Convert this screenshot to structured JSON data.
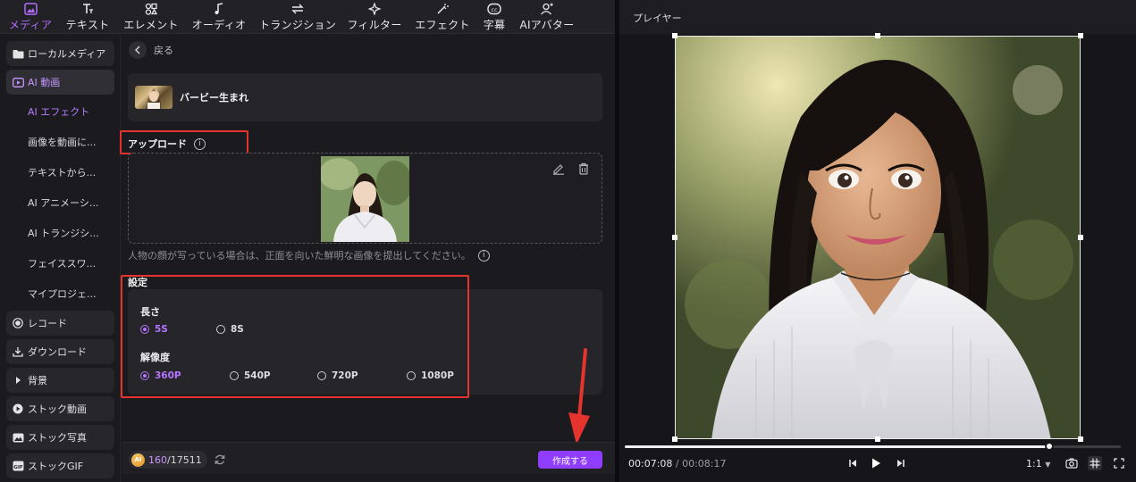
{
  "toolbar": {
    "items": [
      {
        "label": "メディア",
        "icon": "media-icon"
      },
      {
        "label": "テキスト",
        "icon": "text-icon"
      },
      {
        "label": "エレメント",
        "icon": "element-icon"
      },
      {
        "label": "オーディオ",
        "icon": "audio-icon"
      },
      {
        "label": "トランジション",
        "icon": "transition-icon"
      },
      {
        "label": "フィルター",
        "icon": "filter-icon"
      },
      {
        "label": "エフェクト",
        "icon": "effect-icon"
      },
      {
        "label": "字幕",
        "icon": "subtitle-icon"
      },
      {
        "label": "AIアバター",
        "icon": "ai-avatar-icon"
      }
    ],
    "active": "メディア"
  },
  "sidebar": {
    "local_media": "ローカルメディア",
    "ai_video": "AI 動画",
    "sub_items": [
      "AI エフェクト",
      "画像を動画に...",
      "テキストから...",
      "AI アニメーシ...",
      "AI トランジシ...",
      "フェイススワ...",
      "マイプロジェ..."
    ],
    "record": "レコード",
    "download": "ダウンロード",
    "background": "背景",
    "stock_video": "ストック動画",
    "stock_photo": "ストック写真",
    "stock_gif": "ストックGIF"
  },
  "content": {
    "back_label": "戻る",
    "effect_name": "バービー生まれ",
    "upload_title": "アップロード",
    "upload_hint": "人物の顔が写っている場合は、正面を向いた鮮明な画像を提出してください。",
    "settings_title": "設定",
    "length_label": "長さ",
    "length_options": [
      "5S",
      "8S"
    ],
    "length_selected": "5S",
    "resolution_label": "解像度",
    "resolution_options": [
      "360P",
      "540P",
      "720P",
      "1080P"
    ],
    "resolution_selected": "360P"
  },
  "footer": {
    "credits_used": "160",
    "credits_total": "/17511",
    "coin_label": "AI",
    "create_label": "作成する"
  },
  "player": {
    "title": "プレイヤー",
    "current_time": "00:07:08",
    "total_time": "/ 00:08:17",
    "progress": 0.855,
    "ratio": "1:1"
  },
  "colors": {
    "accent": "#8f3dff",
    "accent_text": "#b575ff",
    "highlight_box": "#e5342e"
  }
}
